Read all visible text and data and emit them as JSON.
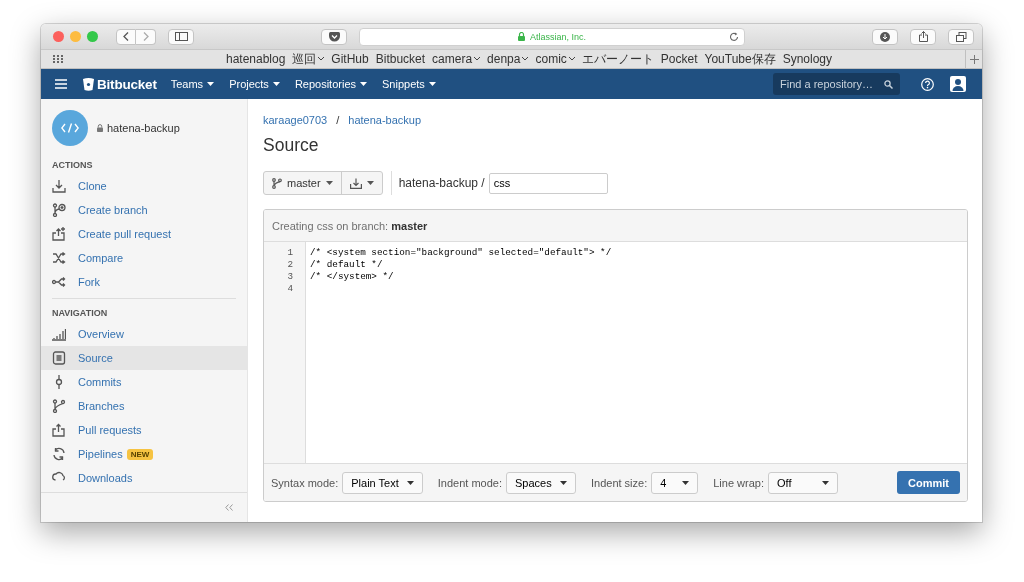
{
  "browser": {
    "address": "Atlassian, Inc.",
    "secure": true,
    "bookmarks": [
      {
        "label": "hatenablog",
        "menu": false
      },
      {
        "label": "巡回",
        "menu": true
      },
      {
        "label": "GitHub",
        "menu": false
      },
      {
        "label": "Bitbucket",
        "menu": false
      },
      {
        "label": "camera",
        "menu": true
      },
      {
        "label": "denpa",
        "menu": true
      },
      {
        "label": "comic",
        "menu": true
      },
      {
        "label": "エバーノート",
        "menu": false
      },
      {
        "label": "Pocket",
        "menu": false
      },
      {
        "label": "YouTube保存",
        "menu": false
      },
      {
        "label": "Synology",
        "menu": false
      }
    ]
  },
  "header": {
    "logo": "Bitbucket",
    "menus": [
      "Teams",
      "Projects",
      "Repositories",
      "Snippets"
    ],
    "search": {
      "placeholder": "Find a repository…"
    }
  },
  "sidebar": {
    "repo": "hatena-backup",
    "private": true,
    "sections": [
      {
        "heading": "ACTIONS",
        "items": [
          {
            "label": "Clone",
            "selected": false
          },
          {
            "label": "Create branch",
            "selected": false
          },
          {
            "label": "Create pull request",
            "selected": false
          },
          {
            "label": "Compare",
            "selected": false
          },
          {
            "label": "Fork",
            "selected": false
          }
        ]
      },
      {
        "heading": "NAVIGATION",
        "items": [
          {
            "label": "Overview",
            "selected": false
          },
          {
            "label": "Source",
            "selected": true
          },
          {
            "label": "Commits",
            "selected": false
          },
          {
            "label": "Branches",
            "selected": false
          },
          {
            "label": "Pull requests",
            "selected": false
          },
          {
            "label": "Pipelines",
            "selected": false,
            "badge": "NEW"
          },
          {
            "label": "Downloads",
            "selected": false
          }
        ]
      }
    ]
  },
  "main": {
    "breadcrumbs": {
      "items": [
        "karaage0703",
        "hatena-backup"
      ],
      "separator": "/"
    },
    "title": "Source",
    "branch": "master",
    "path": "hatena-backup /",
    "filename": "css",
    "editor": {
      "header": "Creating css on branch: **master**",
      "lines": [
        {
          "number": "1",
          "code": "/* <system section=\"background\" selected=\"default\"> */"
        },
        {
          "number": "2",
          "code": "/* default */"
        },
        {
          "number": "3",
          "code": "/* </system> */"
        },
        {
          "number": "4"
        }
      ],
      "options": [
        {
          "label": "Syntax mode:",
          "value": "Plain Text"
        },
        {
          "label": "Indent mode:",
          "value": "Spaces"
        },
        {
          "label": "Indent size:",
          "value": "4"
        },
        {
          "label": "Line wrap:",
          "value": "Off"
        }
      ],
      "button": "Commit"
    }
  }
}
